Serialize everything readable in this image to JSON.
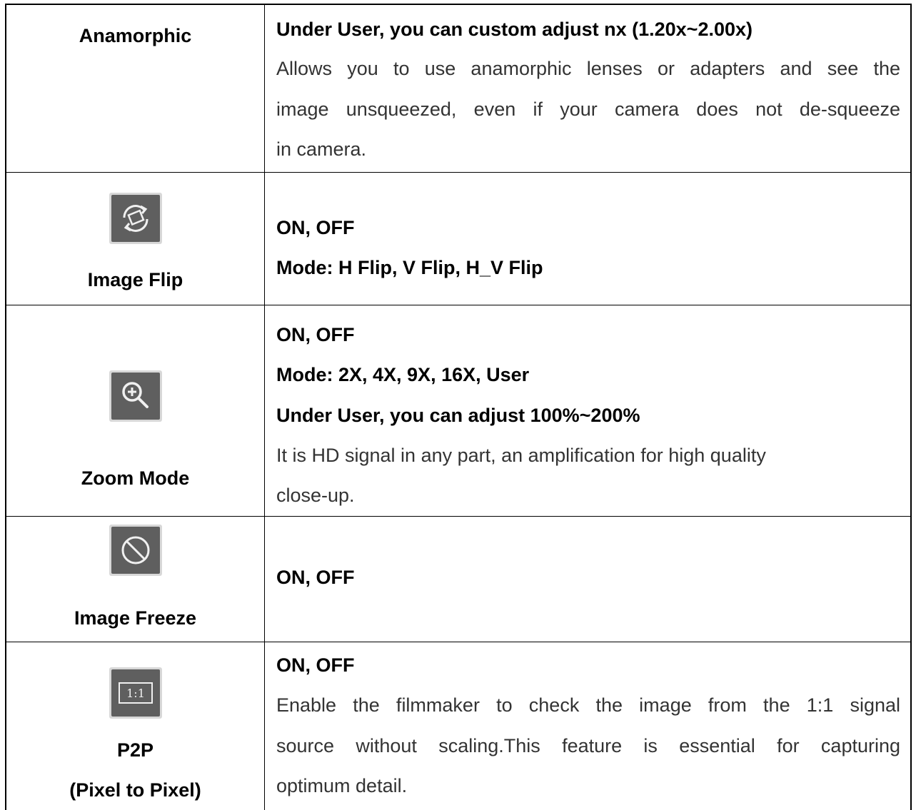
{
  "rows": [
    {
      "label": "Anamorphic",
      "lines": [
        "Under User, you can custom adjust nx (1.20x~2.00x)",
        "Allows you to use anamorphic lenses or adapters and see the",
        "image unsqueezed, even if your camera does not de-squeeze",
        "in camera."
      ]
    },
    {
      "label": "Image Flip",
      "icon": "rotate-flip-icon",
      "lines": [
        "ON, OFF",
        "Mode: H Flip, V Flip, H_V Flip"
      ]
    },
    {
      "label": "Zoom Mode",
      "icon": "zoom-in-icon",
      "lines": [
        "ON, OFF",
        "Mode: 2X, 4X, 9X, 16X, User",
        "Under User, you can adjust 100%~200%",
        "It is HD signal in any part, an amplification for high quality",
        "close-up."
      ]
    },
    {
      "label": "Image Freeze",
      "icon": "no-symbol-icon",
      "lines": [
        "ON, OFF"
      ]
    },
    {
      "label": "P2P",
      "label2": "(Pixel to Pixel)",
      "icon": "one-to-one-icon",
      "icon_text": "1:1",
      "lines": [
        "ON, OFF",
        "Enable the filmmaker to check the image from the 1:1 signal",
        "source without scaling.This feature is essential for capturing",
        "optimum detail."
      ]
    }
  ],
  "colors": {
    "icon_bg": "#5f5f5f",
    "icon_fg": "#f0f0f0",
    "border": "#000000"
  }
}
